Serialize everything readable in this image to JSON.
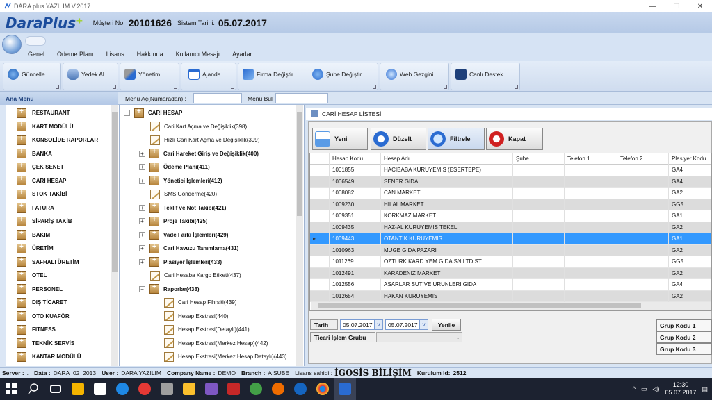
{
  "window": {
    "title": "DARA plus YAZILIM  V.2017",
    "minimize": "—",
    "restore": "❐",
    "close": "✕"
  },
  "header": {
    "brand_main": "DaraPlus",
    "customer_label": "Müşteri No:",
    "customer_no": "20101626",
    "date_label": "Sistem Tarihi:",
    "system_date": "05.07.2017"
  },
  "tabs": [
    "Genel",
    "Ödeme Planı",
    "Lisans",
    "Hakkında",
    "Kullanıcı Mesajı",
    "Ayarlar"
  ],
  "ribbon": {
    "update": "Güncelle",
    "backup": "Yedek Al",
    "manage": "Yönetim",
    "calendar": "Ajanda",
    "change_company": "Firma Değiştir",
    "change_branch": "Şube Değiştir",
    "web": "Web Gezgini",
    "support": "Canlı Destek"
  },
  "menubar": {
    "main_menu": "Ana Menu",
    "open_label": "Menu Aç(Numaradan) :",
    "find_label": "Menu Bul"
  },
  "left_menu": [
    "RESTAURANT",
    "KART MODÜLÜ",
    "KONSOLİDE RAPORLAR",
    "BANKA",
    "ÇEK SENET",
    "CARİ HESAP",
    "STOK TAKİBİ",
    "FATURA",
    "SİPARİŞ TAKİB",
    "BAKIM",
    "ÜRETİM",
    "SAFHALI ÜRETİM",
    "OTEL",
    "PERSONEL",
    "DIŞ TİCARET",
    "OTO KUAFÖR",
    "FITNESS",
    "TEKNİK SERVİS",
    "KANTAR MODÜLÜ"
  ],
  "tree": [
    {
      "label": "CARİ HESAP",
      "kind": "root"
    },
    {
      "label": "Cari Kart Açma ve Değişiklik(398)",
      "kind": "doc"
    },
    {
      "label": "Hızlı Cari Kart Açma ve Değişiklik(399)",
      "kind": "doc"
    },
    {
      "label": "Cari Hareket Giriş ve Değişiklik(400)",
      "kind": "folder"
    },
    {
      "label": "Ödeme Planı(411)",
      "kind": "folder"
    },
    {
      "label": "Yönetici İşlemleri(412)",
      "kind": "folder"
    },
    {
      "label": "SMS Gönderme(420)",
      "kind": "doc"
    },
    {
      "label": "Teklif ve Not Takibi(421)",
      "kind": "folder"
    },
    {
      "label": "Proje Takibi(425)",
      "kind": "folder"
    },
    {
      "label": "Vade Farkı İşlemleri(429)",
      "kind": "folder"
    },
    {
      "label": "Cari Havuzu Tanımlama(431)",
      "kind": "folder"
    },
    {
      "label": "Plasiyer İşlemleri(433)",
      "kind": "folder"
    },
    {
      "label": "Cari Hesaba Kargo Etiketi(437)",
      "kind": "doc"
    },
    {
      "label": "Raporlar(438)",
      "kind": "openfolder"
    },
    {
      "label": "Cari Hesap Fihrsiti(439)",
      "kind": "subdoc"
    },
    {
      "label": "Hesap Ekstresi(440)",
      "kind": "subdoc"
    },
    {
      "label": "Hesap Ekstresi(Detaylı)(441)",
      "kind": "subdoc"
    },
    {
      "label": "Hesap Ekstresi(Merkez Hesap)(442)",
      "kind": "subdoc"
    },
    {
      "label": "Hesap Ekstresi(Merkez Hesap Detaylı)(443)",
      "kind": "subdoc"
    }
  ],
  "form": {
    "title": "CARİ HESAP LİSTESİ",
    "buttons": {
      "new": "Yeni",
      "edit": "Düzelt",
      "filter": "Filtrele",
      "close": "Kapat"
    },
    "columns": [
      "Hesap Kodu",
      "Hesap Adı",
      "Şube",
      "Telefon 1",
      "Telefon 2",
      "Plasiyer Kodu"
    ],
    "rows": [
      [
        "1001855",
        "HACIBABA KURUYEMIS (ESERTEPE)",
        "",
        "",
        "",
        "GA4"
      ],
      [
        "1006549",
        "SENER GIDA",
        "",
        "",
        "",
        "GA4"
      ],
      [
        "1008082",
        "CAN MARKET",
        "",
        "",
        "",
        "GA2"
      ],
      [
        "1009230",
        "HILAL MARKET",
        "",
        "",
        "",
        "GG5"
      ],
      [
        "1009351",
        "KORKMAZ MARKET",
        "",
        "",
        "",
        "GA1"
      ],
      [
        "1009435",
        "HAZ-AL KURUYEMIS TEKEL",
        "",
        "",
        "",
        "GA2"
      ],
      [
        "1009443",
        "OTANTIK KURUYEMIS",
        "",
        "",
        "",
        "GA1"
      ],
      [
        "1010963",
        "MUGE GIDA PAZARI",
        "",
        "",
        "",
        "GA2"
      ],
      [
        "1011269",
        "OZTURK KARD.YEM.GIDA SN.LTD.ST",
        "",
        "",
        "",
        "GG5"
      ],
      [
        "1012491",
        "KARADENIZ MARKET",
        "",
        "",
        "",
        "GA2"
      ],
      [
        "1012556",
        "ASARLAR SUT VE URUNLERI GIDA",
        "",
        "",
        "",
        "GA4"
      ],
      [
        "1012654",
        "HAKAN KURUYEMIS",
        "",
        "",
        "",
        "GA2"
      ]
    ],
    "selected_row_marker": "▸",
    "filter": {
      "date_label": "Tarih",
      "date_from": "05.07.2017",
      "date_to": "05.07.2017",
      "refresh": "Yenile",
      "group_label": "Ticari İşlem Grubu",
      "group_value": ""
    },
    "group_codes": [
      "Grup Kodu 1",
      "Grup Kodu 2",
      "Grup Kodu 3"
    ]
  },
  "status": {
    "server_label": "Server :",
    "server": ".",
    "data_label": "Data :",
    "data": "DARA_02_2013",
    "user_label": "User :",
    "user": "DARA YAZILIM",
    "company_label": "Company Name :",
    "company": "DEMO",
    "branch_label": "Branch :",
    "branch": "A SUBE",
    "license_label": "Lisans sahibi :",
    "license": "İGOSİS BİLİŞİM",
    "install_label": "Kurulum Id:",
    "install": "2512"
  },
  "taskbar": {
    "time": "12:30",
    "date": "05.07.2017",
    "tray_arrow": "^"
  },
  "colors": {
    "accent": "#1b4c9c",
    "selection": "#3399ff",
    "brand_green": "#9fd12a"
  }
}
